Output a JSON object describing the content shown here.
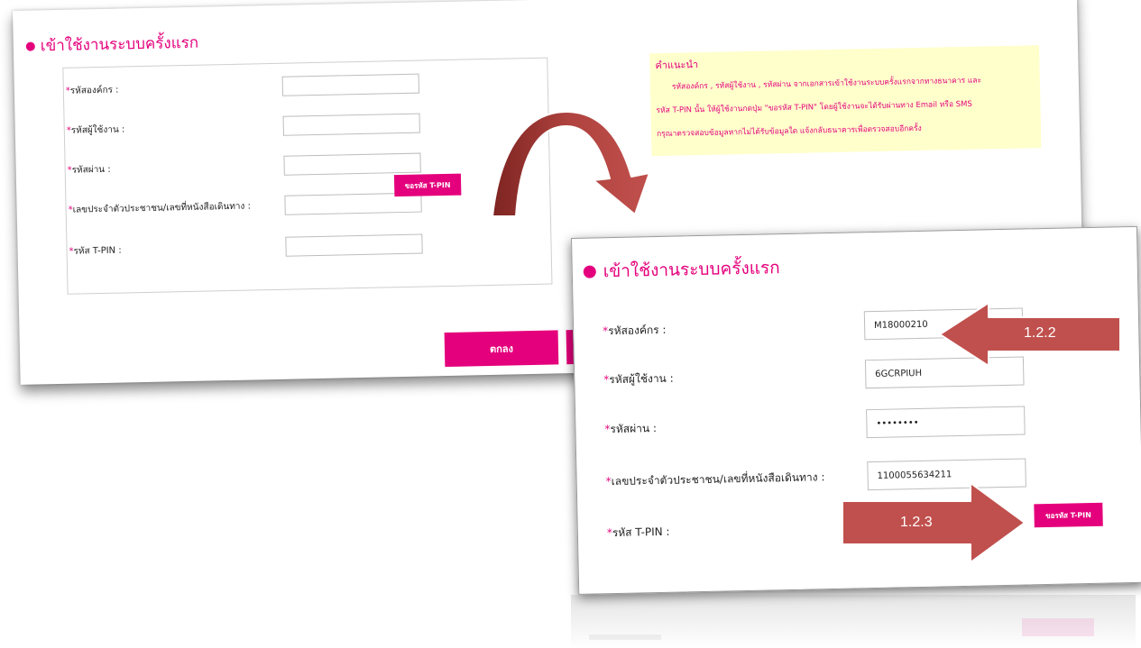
{
  "form": {
    "title": "เข้าใช้งานระบบครั้งแรก",
    "required_mark": "*",
    "fields": [
      {
        "label": "รหัสองค์กร :",
        "value": "M18000210"
      },
      {
        "label": "รหัสผู้ใช้งาน :",
        "value": "6GCRPIUH"
      },
      {
        "label": "รหัสผ่าน :",
        "value": "••••••••"
      },
      {
        "label": "เลขประจำตัวประชาชน/เลขที่หนังสือเดินทาง :",
        "value": "1100055634211"
      },
      {
        "label": "รหัส T-PIN :",
        "value": ""
      }
    ],
    "request_tpin_button": "ขอรหัส T-PIN",
    "ok_button": "ตกลง"
  },
  "advice": {
    "heading": "คำแนะนำ",
    "lines": [
      "รหัสองค์กร , รหัสผู้ใช้งาน , รหัสผ่าน จากเอกสารเข้าใช้งานระบบครั้งแรกจากทางธนาคาร และ",
      "รหัส T-PIN นั้น ให้ผู้ใช้งานกดปุ่ม \"ขอรหัส T-PIN\" โดยผู้ใช้งานจะได้รับผ่านทาง Email หรือ SMS",
      "กรุณาตรวจสอบข้อมูลหากไม่ได้รับข้อมูลใด แจ้งกลับธนาคารเพื่อตรวจสอบอีกครั้ง"
    ]
  },
  "callouts": {
    "step_1": "1.2.2",
    "step_2": "1.2.3"
  },
  "colors": {
    "accent": "#e4007c",
    "advice_bg": "#ffffcc",
    "arrow": "#c0504d",
    "arrow_dark": "#8e2a27"
  }
}
